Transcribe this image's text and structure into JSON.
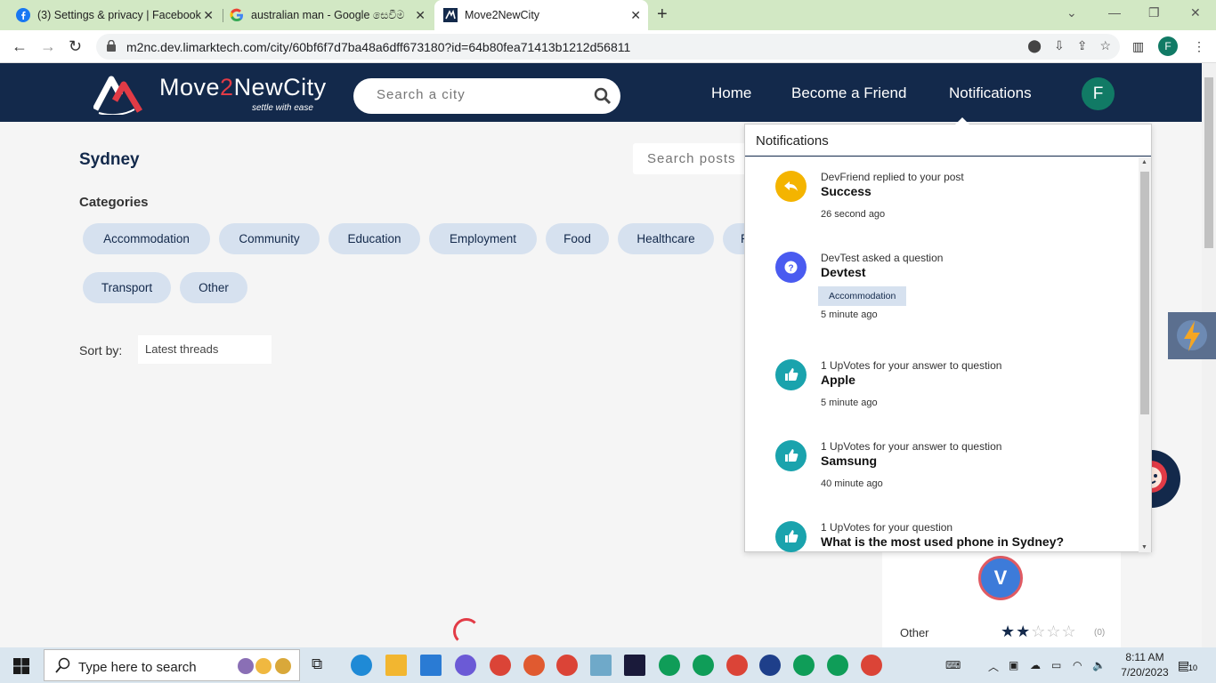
{
  "browser": {
    "tabs": [
      {
        "title": "(3) Settings & privacy | Facebook",
        "icon": "facebook-icon",
        "active": false
      },
      {
        "title": "australian man - Google සෙවීම",
        "icon": "google-icon",
        "active": false
      },
      {
        "title": "Move2NewCity",
        "icon": "move2newcity-icon",
        "active": true
      }
    ],
    "url": "m2nc.dev.limarktech.com/city/60bf6f7d7ba48a6dff673180?id=64b80fea71413b1212d56811",
    "profile_initial": "F"
  },
  "site": {
    "logo": {
      "part1": "Move",
      "part2": "2",
      "part3": "NewCity",
      "tagline": "settle with ease"
    },
    "city_search_placeholder": "Search a city",
    "nav": {
      "home": "Home",
      "friend": "Become a Friend",
      "notifications": "Notifications"
    },
    "avatar_initial": "F"
  },
  "page": {
    "city": "Sydney",
    "search_posts_placeholder": "Search posts",
    "categories_heading": "Categories",
    "categories": [
      "Accommodation",
      "Community",
      "Education",
      "Employment",
      "Food",
      "Healthcare",
      "R",
      "Transport",
      "Other"
    ],
    "sort_label": "Sort by:",
    "sort_value": "Latest threads"
  },
  "user_card": {
    "avatar_initial": "V",
    "rating_label": "Other",
    "rating_stars": 2,
    "rating_max": 5,
    "rating_count": "(0)"
  },
  "notifications": {
    "title": "Notifications",
    "items": [
      {
        "icon": "reply-icon",
        "color": "#f4b400",
        "line1": "DevFriend replied to your post",
        "line2": "Success",
        "time": "26 second ago",
        "tag": ""
      },
      {
        "icon": "question-icon",
        "color": "#4a5bf0",
        "line1": "DevTest  asked a question",
        "line2": "Devtest",
        "time": "5 minute ago",
        "tag": "Accommodation"
      },
      {
        "icon": "thumbs-up-icon",
        "color": "#1aa3ad",
        "line1": "1  UpVotes for your answer to question",
        "line2": "Apple",
        "time": "5 minute ago",
        "tag": ""
      },
      {
        "icon": "thumbs-up-icon",
        "color": "#1aa3ad",
        "line1": "1  UpVotes for your answer to question",
        "line2": "Samsung",
        "time": "40 minute ago",
        "tag": ""
      },
      {
        "icon": "thumbs-up-icon",
        "color": "#1aa3ad",
        "line1": "1  UpVotes for your question",
        "line2": "What is the most used phone in Sydney?",
        "time": "",
        "tag": ""
      }
    ]
  },
  "taskbar": {
    "search_placeholder": "Type here to search",
    "time": "8:11 AM",
    "date": "7/20/2023",
    "notification_count": "10"
  },
  "colors": {
    "navy": "#13294b",
    "accent": "#e23b46",
    "chip": "#d6e1ef",
    "green": "#117a65"
  }
}
